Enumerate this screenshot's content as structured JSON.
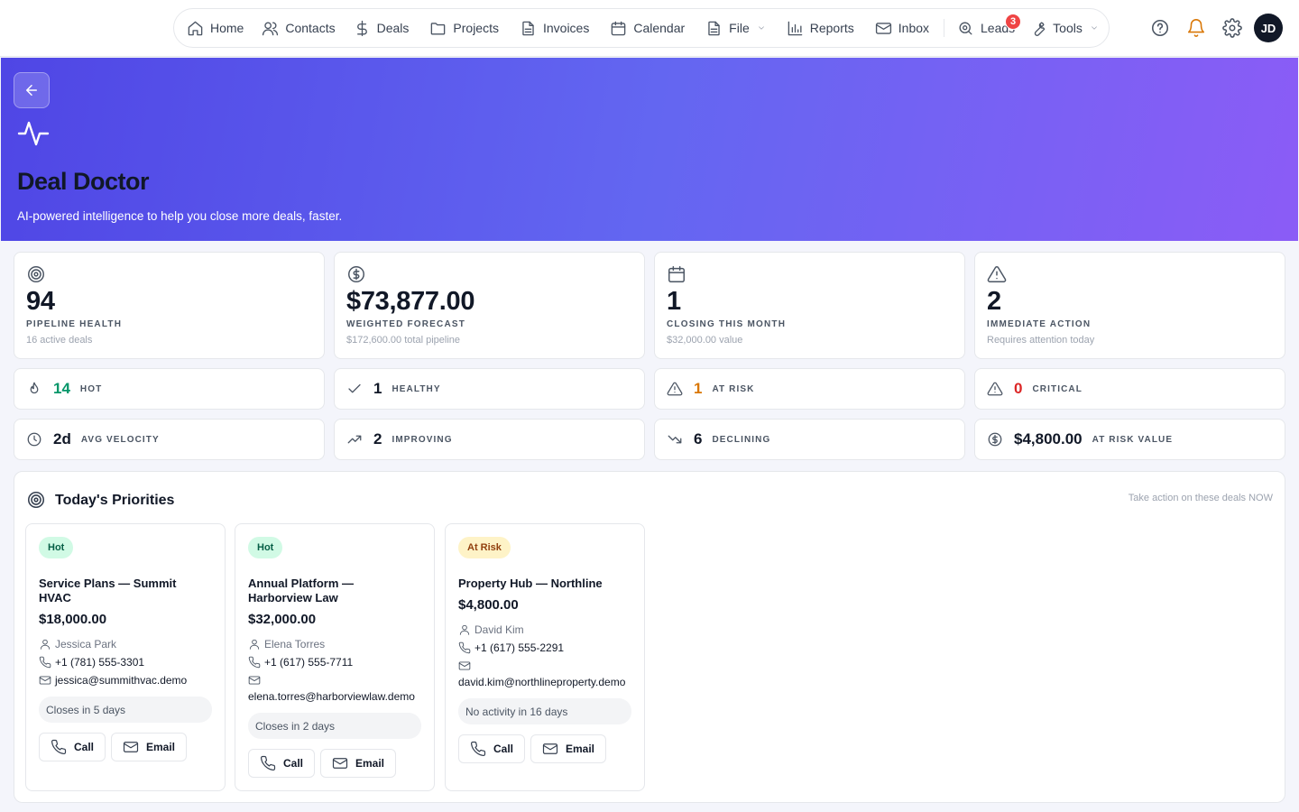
{
  "nav": {
    "items": [
      {
        "label": "Home",
        "icon": "home-icon"
      },
      {
        "label": "Contacts",
        "icon": "users-icon"
      },
      {
        "label": "Deals",
        "icon": "dollar-icon"
      },
      {
        "label": "Projects",
        "icon": "folder-icon"
      },
      {
        "label": "Invoices",
        "icon": "file-icon"
      },
      {
        "label": "Calendar",
        "icon": "calendar-icon"
      },
      {
        "label": "File",
        "icon": "file-icon"
      },
      {
        "label": "Reports",
        "icon": "bar-chart-icon"
      },
      {
        "label": "Inbox",
        "icon": "mail-icon"
      },
      {
        "label": "Leads",
        "icon": "search-icon",
        "badge": "3"
      },
      {
        "label": "Tools",
        "icon": "wrench-icon"
      }
    ],
    "avatar": "JD"
  },
  "hero": {
    "title": "Deal Doctor",
    "subtitle": "AI-powered intelligence to help you close more deals, faster."
  },
  "stats": [
    {
      "value": "94",
      "label": "PIPELINE HEALTH",
      "sub": "16 active deals",
      "icon": "target-icon"
    },
    {
      "value": "$73,877.00",
      "label": "WEIGHTED FORECAST",
      "sub": "$172,600.00 total pipeline",
      "icon": "dollar-circle-icon"
    },
    {
      "value": "1",
      "label": "CLOSING THIS MONTH",
      "sub": "$32,000.00 value",
      "icon": "calendar-icon"
    },
    {
      "value": "2",
      "label": "IMMEDIATE ACTION",
      "sub": "Requires attention today",
      "icon": "alert-triangle-icon"
    }
  ],
  "metrics": [
    {
      "value": "14",
      "label": "HOT",
      "color": "#059669",
      "icon": "flame-icon"
    },
    {
      "value": "1",
      "label": "HEALTHY",
      "color": "#111827",
      "icon": "check-icon"
    },
    {
      "value": "1",
      "label": "AT RISK",
      "color": "#d97706",
      "icon": "alert-triangle-icon"
    },
    {
      "value": "0",
      "label": "CRITICAL",
      "color": "#dc2626",
      "icon": "alert-triangle-icon"
    },
    {
      "value": "2d",
      "label": "AVG VELOCITY",
      "color": "#111827",
      "icon": "clock-icon"
    },
    {
      "value": "2",
      "label": "IMPROVING",
      "color": "#111827",
      "icon": "trending-up-icon"
    },
    {
      "value": "6",
      "label": "DECLINING",
      "color": "#111827",
      "icon": "trending-down-icon"
    },
    {
      "value": "$4,800.00",
      "label": "AT RISK VALUE",
      "color": "#111827",
      "icon": "dollar-circle-icon"
    }
  ],
  "priorities": {
    "title": "Today's Priorities",
    "note": "Take action on these deals NOW",
    "deals": [
      {
        "tag": "Hot",
        "name": "Service Plans — Summit HVAC",
        "amount": "$18,000.00",
        "contact": "Jessica Park",
        "phone": "+1 (781) 555-3301",
        "email": "jessica@summithvac.demo",
        "status": "Closes in 5 days",
        "call": "Call",
        "email_btn": "Email"
      },
      {
        "tag": "Hot",
        "name": "Annual Platform — Harborview Law",
        "amount": "$32,000.00",
        "contact": "Elena Torres",
        "phone": "+1 (617) 555-7711",
        "email": "elena.torres@harborviewlaw.demo",
        "status": "Closes in 2 days",
        "call": "Call",
        "email_btn": "Email"
      },
      {
        "tag": "At Risk",
        "name": "Property Hub — Northline",
        "amount": "$4,800.00",
        "contact": "David Kim",
        "phone": "+1 (617) 555-2291",
        "email": "david.kim@northlineproperty.demo",
        "status": "No activity in 16 days",
        "call": "Call",
        "email_btn": "Email"
      }
    ]
  }
}
